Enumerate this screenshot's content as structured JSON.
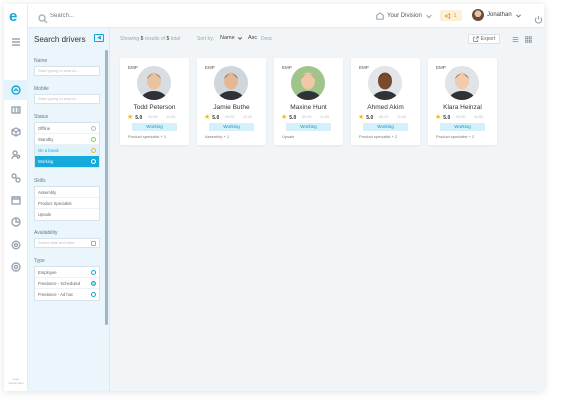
{
  "app": {
    "logo_letter": "e",
    "footer_text": "Logo placeholder"
  },
  "topbar": {
    "search_placeholder": "Search...",
    "division_label": "Your Division",
    "notification_count": "1",
    "user_name": "Jonathan"
  },
  "filter": {
    "title": "Search drivers",
    "name_label": "Name",
    "name_placeholder": "Start typing to search...",
    "mobile_label": "Mobile",
    "mobile_placeholder": "Start typing to search...",
    "status_label": "Status",
    "status_items": [
      "Offline",
      "Standby",
      "On a break",
      "Working"
    ],
    "skills_label": "Skills",
    "skills_items": [
      "Assembly",
      "Product Specialist",
      "Upsale"
    ],
    "availability_label": "Availability",
    "availability_placeholder": "Select date and time",
    "type_label": "Type",
    "type_items": [
      "Employee",
      "Freelance - Scheduled",
      "Freelance - Ad hoc"
    ]
  },
  "toolbar": {
    "showing_prefix": "Showing",
    "showing_count": "5",
    "showing_mid": "results of",
    "showing_total": "5",
    "showing_suffix": "total",
    "sort_label": "Sort by:",
    "sort_value": "Name",
    "asc_label": "Asc",
    "desc_label": "Desc",
    "export_label": "Export"
  },
  "drivers": [
    {
      "badge": "EMP",
      "name": "Todd Peterson",
      "rating": "5.0",
      "time_a": "00:00",
      "time_b": "11:00",
      "status": "Working",
      "skills": "Product specialist + 1",
      "skin": "#e9c2a0",
      "hair": "#3b2a1e",
      "bg": "#d7dde2"
    },
    {
      "badge": "EMP",
      "name": "Jamie Buthe",
      "rating": "5.0",
      "time_a": "00:00",
      "time_b": "11:00",
      "status": "Working",
      "skills": "Assembly + 1",
      "skin": "#e5b895",
      "hair": "#2c2118",
      "bg": "#cfd6dc"
    },
    {
      "badge": "EMP",
      "name": "Maxine Hunt",
      "rating": "5.0",
      "time_a": "00:00",
      "time_b": "11:00",
      "status": "Working",
      "skills": "Upsale",
      "skin": "#f0c8a6",
      "hair": "#a5623a",
      "bg": "#9fc58a"
    },
    {
      "badge": "EMP",
      "name": "Ahmed Akim",
      "rating": "5.0",
      "time_a": "00:00",
      "time_b": "11:00",
      "status": "Working",
      "skills": "Product specialist + 2",
      "skin": "#7a4a2e",
      "hair": "#1b1410",
      "bg": "#e3e6e8"
    },
    {
      "badge": "EMP",
      "name": "Klara Heinzal",
      "rating": "5.0",
      "time_a": "00:00",
      "time_b": "11:00",
      "status": "Working",
      "skills": "Product specialist + 2",
      "skin": "#f1cbae",
      "hair": "#2a1f1a",
      "bg": "#e0e4e7"
    }
  ]
}
